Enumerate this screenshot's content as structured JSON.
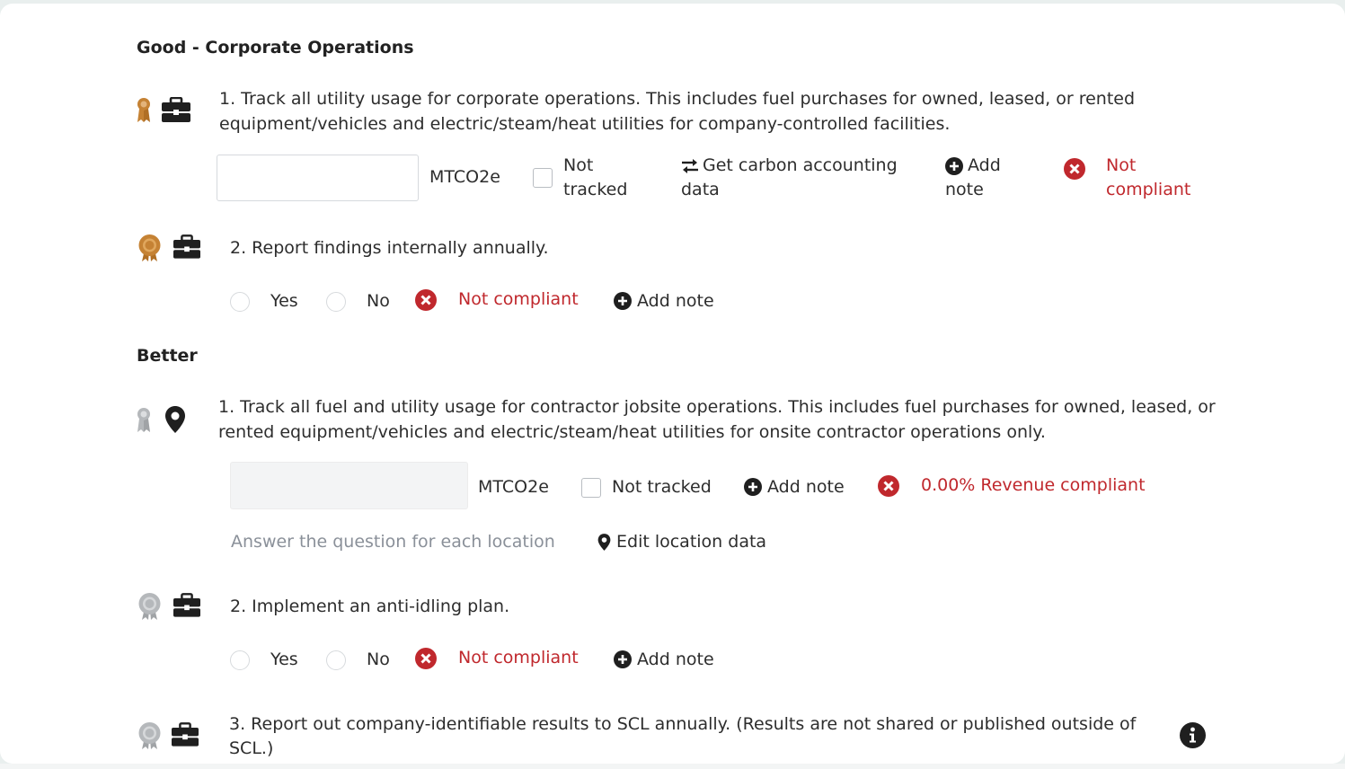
{
  "sections": {
    "good": {
      "title": "Good - Corporate Operations"
    },
    "better": {
      "title": "Better"
    }
  },
  "good_q1": {
    "text": "1. Track all utility usage for corporate operations. This includes fuel purchases for owned, leased, or rented equipment/vehicles and electric/steam/heat utilities for company-controlled facilities.",
    "unit": "MTCO2e",
    "not_tracked_line1": "Not",
    "not_tracked_line2": "tracked",
    "carbon_line1": "Get carbon accounting",
    "carbon_line2": "data",
    "add_note_line1": "Add",
    "add_note_line2": "note",
    "status_line1": "Not",
    "status_line2": "compliant",
    "input_value": ""
  },
  "good_q2": {
    "text": "2. Report findings internally annually.",
    "yes": "Yes",
    "no": "No",
    "status": "Not compliant",
    "add_note": "Add note"
  },
  "better_q1": {
    "text": "1. Track all fuel and utility usage for contractor jobsite operations. This includes fuel purchases for owned, leased, or rented equipment/vehicles and electric/steam/heat utilities for onsite contractor operations only.",
    "unit": "MTCO2e",
    "not_tracked": "Not tracked",
    "add_note": "Add note",
    "status": "0.00% Revenue compliant",
    "location_hint": "Answer the question for each location",
    "edit_location": "Edit location data",
    "input_value": ""
  },
  "better_q2": {
    "text": "2. Implement an anti-idling plan.",
    "yes": "Yes",
    "no": "No",
    "status": "Not compliant",
    "add_note": "Add note"
  },
  "better_q3": {
    "text": "3. Report out company-identifiable results to SCL annually. (Results are not shared or published outside of SCL.)"
  },
  "colors": {
    "bronze": "#c58234",
    "silver": "#b5b8bb",
    "danger": "#c0282d",
    "icon_dark": "#1f1f1f"
  },
  "icons": [
    "award-bronze-icon",
    "award-silver-icon",
    "briefcase-icon",
    "map-pin-icon",
    "exchange-arrows-icon",
    "plus-circle-icon",
    "x-circle-icon",
    "info-circle-icon"
  ]
}
